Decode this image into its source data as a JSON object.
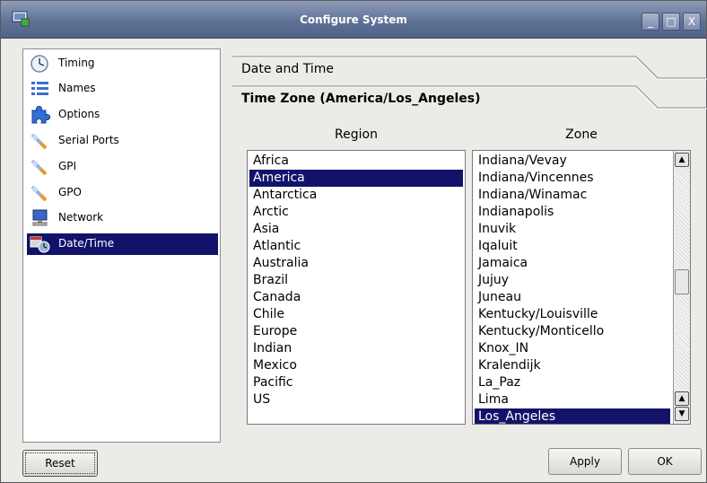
{
  "window": {
    "title": "Configure System",
    "controls": {
      "minimize": "_",
      "maximize": "□",
      "close": "X"
    }
  },
  "sidebar": {
    "items": [
      {
        "label": "Timing",
        "icon": "clock-icon",
        "selected": false
      },
      {
        "label": "Names",
        "icon": "list-icon",
        "selected": false
      },
      {
        "label": "Options",
        "icon": "puzzle-icon",
        "selected": false
      },
      {
        "label": "Serial Ports",
        "icon": "wrench-icon",
        "selected": false
      },
      {
        "label": "GPI",
        "icon": "wrench-icon",
        "selected": false
      },
      {
        "label": "GPO",
        "icon": "wrench-icon",
        "selected": false
      },
      {
        "label": "Network",
        "icon": "computer-icon",
        "selected": false
      },
      {
        "label": "Date/Time",
        "icon": "calendar-clock-icon",
        "selected": true
      }
    ]
  },
  "main": {
    "section_date_time": "Date and Time",
    "section_time_zone": "Time Zone  (America/Los_Angeles)",
    "region_header": "Region",
    "zone_header": "Zone",
    "regions": [
      "Africa",
      "America",
      "Antarctica",
      "Arctic",
      "Asia",
      "Atlantic",
      "Australia",
      "Brazil",
      "Canada",
      "Chile",
      "Europe",
      "Indian",
      "Mexico",
      "Pacific",
      "US"
    ],
    "selected_region": "America",
    "zones": [
      "Indiana/Vevay",
      "Indiana/Vincennes",
      "Indiana/Winamac",
      "Indianapolis",
      "Inuvik",
      "Iqaluit",
      "Jamaica",
      "Jujuy",
      "Juneau",
      "Kentucky/Louisville",
      "Kentucky/Monticello",
      "Knox_IN",
      "Kralendijk",
      "La_Paz",
      "Lima",
      "Los_Angeles"
    ],
    "selected_zone": "Los_Angeles"
  },
  "buttons": {
    "reset": "Reset",
    "apply": "Apply",
    "ok": "OK"
  },
  "colors": {
    "selection": "#12126b",
    "titlebar": "#5f7296",
    "background": "#ebebe8"
  }
}
